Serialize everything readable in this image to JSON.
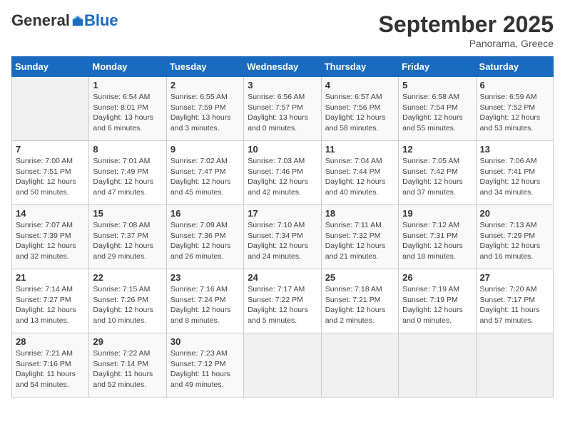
{
  "header": {
    "logo": {
      "general": "General",
      "blue": "Blue",
      "tagline": ""
    },
    "title": "September 2025",
    "subtitle": "Panorama, Greece"
  },
  "days_of_week": [
    "Sunday",
    "Monday",
    "Tuesday",
    "Wednesday",
    "Thursday",
    "Friday",
    "Saturday"
  ],
  "weeks": [
    [
      {
        "day": "",
        "info": ""
      },
      {
        "day": "1",
        "info": "Sunrise: 6:54 AM\nSunset: 8:01 PM\nDaylight: 13 hours\nand 6 minutes."
      },
      {
        "day": "2",
        "info": "Sunrise: 6:55 AM\nSunset: 7:59 PM\nDaylight: 13 hours\nand 3 minutes."
      },
      {
        "day": "3",
        "info": "Sunrise: 6:56 AM\nSunset: 7:57 PM\nDaylight: 13 hours\nand 0 minutes."
      },
      {
        "day": "4",
        "info": "Sunrise: 6:57 AM\nSunset: 7:56 PM\nDaylight: 12 hours\nand 58 minutes."
      },
      {
        "day": "5",
        "info": "Sunrise: 6:58 AM\nSunset: 7:54 PM\nDaylight: 12 hours\nand 55 minutes."
      },
      {
        "day": "6",
        "info": "Sunrise: 6:59 AM\nSunset: 7:52 PM\nDaylight: 12 hours\nand 53 minutes."
      }
    ],
    [
      {
        "day": "7",
        "info": "Sunrise: 7:00 AM\nSunset: 7:51 PM\nDaylight: 12 hours\nand 50 minutes."
      },
      {
        "day": "8",
        "info": "Sunrise: 7:01 AM\nSunset: 7:49 PM\nDaylight: 12 hours\nand 47 minutes."
      },
      {
        "day": "9",
        "info": "Sunrise: 7:02 AM\nSunset: 7:47 PM\nDaylight: 12 hours\nand 45 minutes."
      },
      {
        "day": "10",
        "info": "Sunrise: 7:03 AM\nSunset: 7:46 PM\nDaylight: 12 hours\nand 42 minutes."
      },
      {
        "day": "11",
        "info": "Sunrise: 7:04 AM\nSunset: 7:44 PM\nDaylight: 12 hours\nand 40 minutes."
      },
      {
        "day": "12",
        "info": "Sunrise: 7:05 AM\nSunset: 7:42 PM\nDaylight: 12 hours\nand 37 minutes."
      },
      {
        "day": "13",
        "info": "Sunrise: 7:06 AM\nSunset: 7:41 PM\nDaylight: 12 hours\nand 34 minutes."
      }
    ],
    [
      {
        "day": "14",
        "info": "Sunrise: 7:07 AM\nSunset: 7:39 PM\nDaylight: 12 hours\nand 32 minutes."
      },
      {
        "day": "15",
        "info": "Sunrise: 7:08 AM\nSunset: 7:37 PM\nDaylight: 12 hours\nand 29 minutes."
      },
      {
        "day": "16",
        "info": "Sunrise: 7:09 AM\nSunset: 7:36 PM\nDaylight: 12 hours\nand 26 minutes."
      },
      {
        "day": "17",
        "info": "Sunrise: 7:10 AM\nSunset: 7:34 PM\nDaylight: 12 hours\nand 24 minutes."
      },
      {
        "day": "18",
        "info": "Sunrise: 7:11 AM\nSunset: 7:32 PM\nDaylight: 12 hours\nand 21 minutes."
      },
      {
        "day": "19",
        "info": "Sunrise: 7:12 AM\nSunset: 7:31 PM\nDaylight: 12 hours\nand 18 minutes."
      },
      {
        "day": "20",
        "info": "Sunrise: 7:13 AM\nSunset: 7:29 PM\nDaylight: 12 hours\nand 16 minutes."
      }
    ],
    [
      {
        "day": "21",
        "info": "Sunrise: 7:14 AM\nSunset: 7:27 PM\nDaylight: 12 hours\nand 13 minutes."
      },
      {
        "day": "22",
        "info": "Sunrise: 7:15 AM\nSunset: 7:26 PM\nDaylight: 12 hours\nand 10 minutes."
      },
      {
        "day": "23",
        "info": "Sunrise: 7:16 AM\nSunset: 7:24 PM\nDaylight: 12 hours\nand 8 minutes."
      },
      {
        "day": "24",
        "info": "Sunrise: 7:17 AM\nSunset: 7:22 PM\nDaylight: 12 hours\nand 5 minutes."
      },
      {
        "day": "25",
        "info": "Sunrise: 7:18 AM\nSunset: 7:21 PM\nDaylight: 12 hours\nand 2 minutes."
      },
      {
        "day": "26",
        "info": "Sunrise: 7:19 AM\nSunset: 7:19 PM\nDaylight: 12 hours\nand 0 minutes."
      },
      {
        "day": "27",
        "info": "Sunrise: 7:20 AM\nSunset: 7:17 PM\nDaylight: 11 hours\nand 57 minutes."
      }
    ],
    [
      {
        "day": "28",
        "info": "Sunrise: 7:21 AM\nSunset: 7:16 PM\nDaylight: 11 hours\nand 54 minutes."
      },
      {
        "day": "29",
        "info": "Sunrise: 7:22 AM\nSunset: 7:14 PM\nDaylight: 11 hours\nand 52 minutes."
      },
      {
        "day": "30",
        "info": "Sunrise: 7:23 AM\nSunset: 7:12 PM\nDaylight: 11 hours\nand 49 minutes."
      },
      {
        "day": "",
        "info": ""
      },
      {
        "day": "",
        "info": ""
      },
      {
        "day": "",
        "info": ""
      },
      {
        "day": "",
        "info": ""
      }
    ]
  ]
}
